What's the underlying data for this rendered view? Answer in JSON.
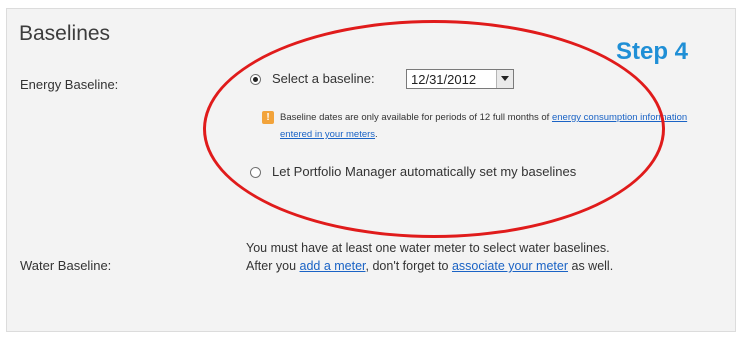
{
  "section": {
    "title": "Baselines"
  },
  "annotation": {
    "step_label": "Step 4",
    "ellipse_color": "#e01b1b"
  },
  "energy": {
    "label": "Energy Baseline:",
    "option_select": {
      "label": "Select a baseline:",
      "selected": true
    },
    "date_select": {
      "value": "12/31/2012"
    },
    "note": {
      "text": "Baseline dates are only available for periods of 12 full months of ",
      "link": "energy consumption information entered in your meters",
      "suffix": "."
    },
    "option_auto": {
      "label": "Let Portfolio Manager automatically set my baselines",
      "selected": false
    }
  },
  "water": {
    "label": "Water Baseline:",
    "line1": "You must have at least one water meter to select water baselines.",
    "line2_prefix": "After you ",
    "link_add_meter": "add a meter",
    "line2_middle": ", don't forget to ",
    "link_associate": "associate your meter",
    "line2_suffix": " as well."
  },
  "colors": {
    "link": "#1a63c5",
    "step": "#1f8fd6",
    "panel": "#f3f3f3"
  }
}
